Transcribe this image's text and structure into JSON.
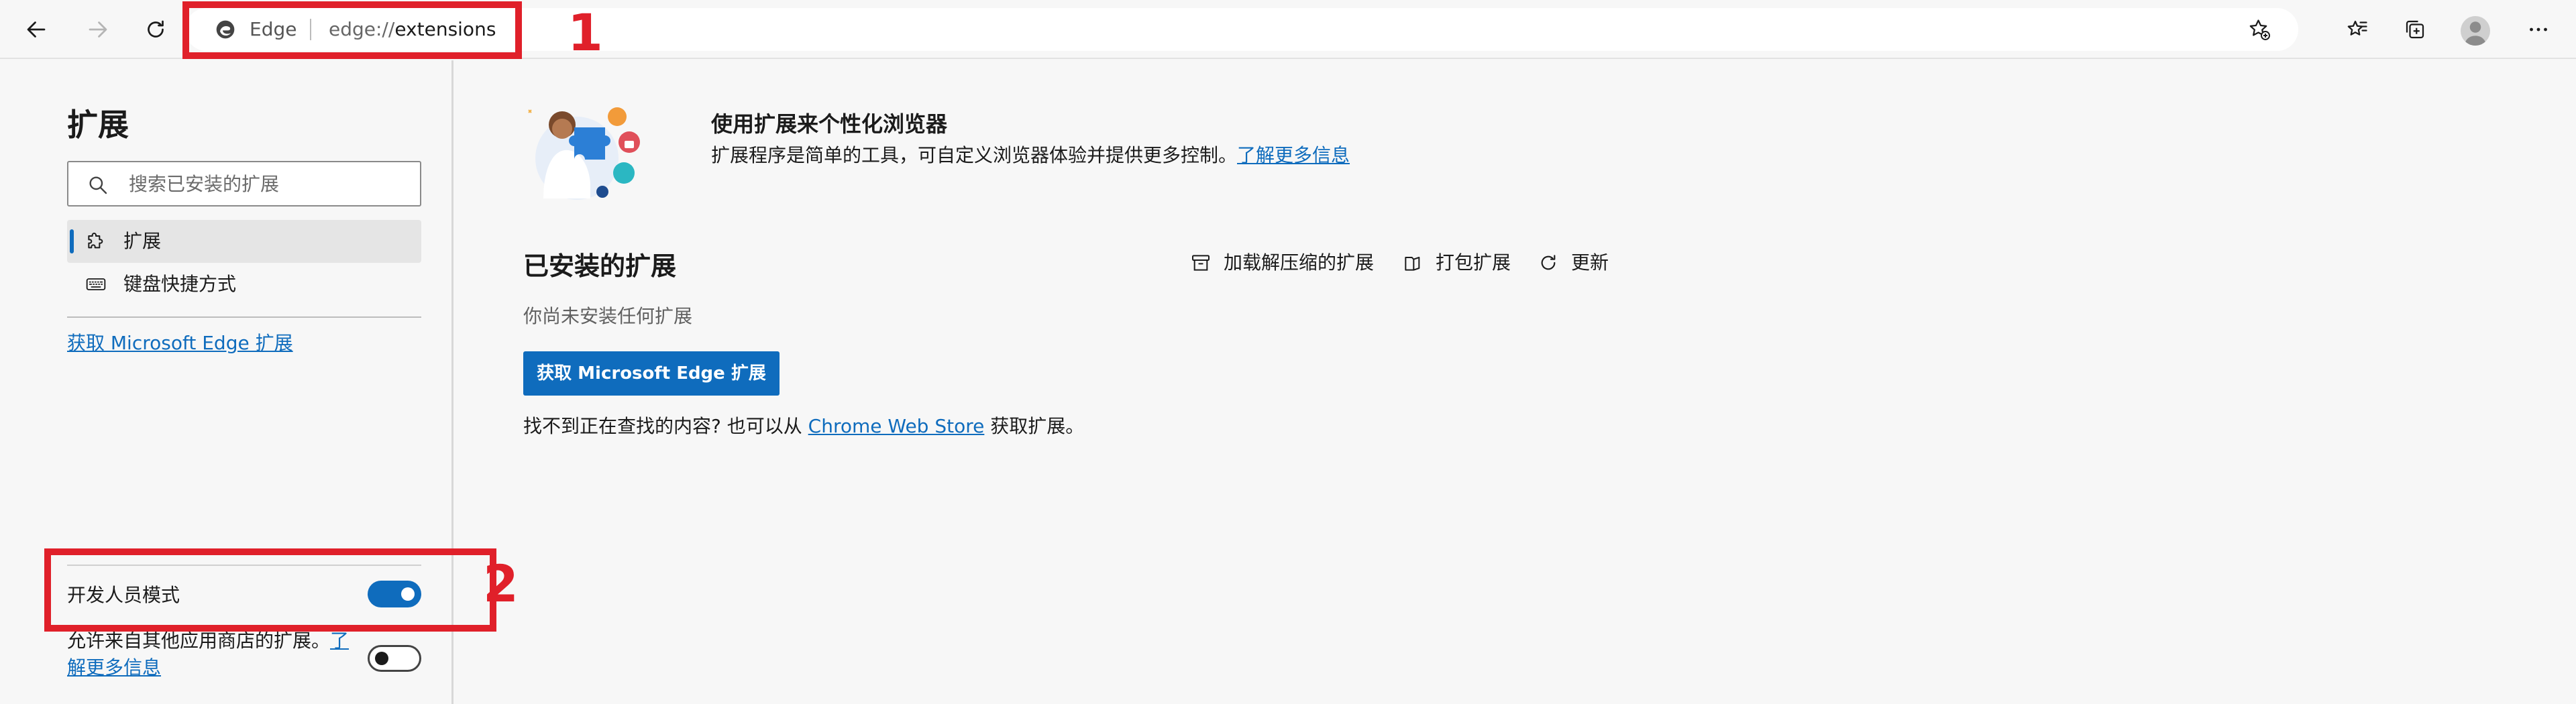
{
  "toolbar": {
    "address": {
      "brand": "Edge",
      "scheme": "edge://",
      "path": "extensions"
    }
  },
  "annotations": [
    {
      "label": "1",
      "target": "address-bar"
    },
    {
      "label": "2",
      "target": "developer-mode"
    }
  ],
  "sidebar": {
    "title": "扩展",
    "search": {
      "placeholder": "搜索已安装的扩展",
      "value": ""
    },
    "items": [
      {
        "label": "扩展",
        "icon": "puzzle-icon",
        "active": true
      },
      {
        "label": "键盘快捷方式",
        "icon": "keyboard-icon",
        "active": false
      }
    ],
    "get_link": "获取 Microsoft Edge 扩展",
    "developer_mode": {
      "label": "开发人员模式",
      "on": true
    },
    "allow_other_stores": {
      "text": "允许来自其他应用商店的扩展。",
      "link": "了解更多信息",
      "on": false
    }
  },
  "main": {
    "hero": {
      "title": "使用扩展来个性化浏览器",
      "description": "扩展程序是简单的工具，可自定义浏览器体验并提供更多控制。",
      "learn_more": "了解更多信息"
    },
    "installed": {
      "title": "已安装的扩展",
      "actions": [
        {
          "label": "加载解压缩的扩展",
          "icon": "archive-icon"
        },
        {
          "label": "打包扩展",
          "icon": "package-icon"
        },
        {
          "label": "更新",
          "icon": "refresh-icon"
        }
      ],
      "empty_text": "你尚未安装任何扩展",
      "get_button": "获取 Microsoft Edge 扩展",
      "cant_find_prefix": "找不到正在查找的内容? 也可以从 ",
      "chrome_store": "Chrome Web Store",
      "cant_find_suffix": " 获取扩展。"
    }
  },
  "colors": {
    "accent": "#0f6cbd",
    "annotation": "#e0202a"
  }
}
